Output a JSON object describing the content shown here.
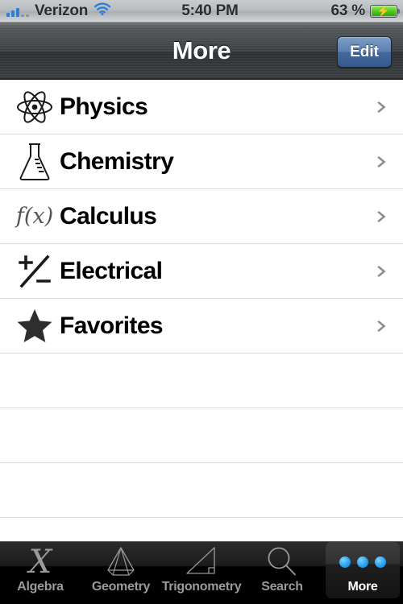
{
  "status_bar": {
    "carrier": "Verizon",
    "signal_icon": "signal-bars-icon",
    "signal_bars_active": 3,
    "signal_bars_total": 5,
    "wifi_icon": "wifi-icon",
    "time": "5:40 PM",
    "battery_percent": "63 %",
    "battery_level": 63,
    "battery_charging": true,
    "battery_icon": "battery-charging-icon"
  },
  "nav_bar": {
    "title": "More",
    "edit_label": "Edit"
  },
  "list": {
    "rows": [
      {
        "label": "Physics",
        "icon": "atom-icon"
      },
      {
        "label": "Chemistry",
        "icon": "flask-icon"
      },
      {
        "label": "Calculus",
        "icon": "function-fx-icon"
      },
      {
        "label": "Electrical",
        "icon": "plus-minus-icon"
      },
      {
        "label": "Favorites",
        "icon": "star-icon"
      }
    ],
    "empty_row_count": 3,
    "disclosure_icon": "chevron-right-icon"
  },
  "tab_bar": {
    "tabs": [
      {
        "label": "Algebra",
        "icon": "algebra-x-icon",
        "selected": false
      },
      {
        "label": "Geometry",
        "icon": "pyramid-icon",
        "selected": false
      },
      {
        "label": "Trigonometry",
        "icon": "right-triangle-icon",
        "selected": false
      },
      {
        "label": "Search",
        "icon": "magnifier-icon",
        "selected": false
      },
      {
        "label": "More",
        "icon": "three-dots-icon",
        "selected": true
      }
    ]
  },
  "colors": {
    "accent_blue": "#2aa3ef",
    "edit_button_blue": "#5b81b1",
    "battery_green": "#4fc91d",
    "separator": "#dcdcdc",
    "tab_inactive": "#9a9a9a"
  }
}
